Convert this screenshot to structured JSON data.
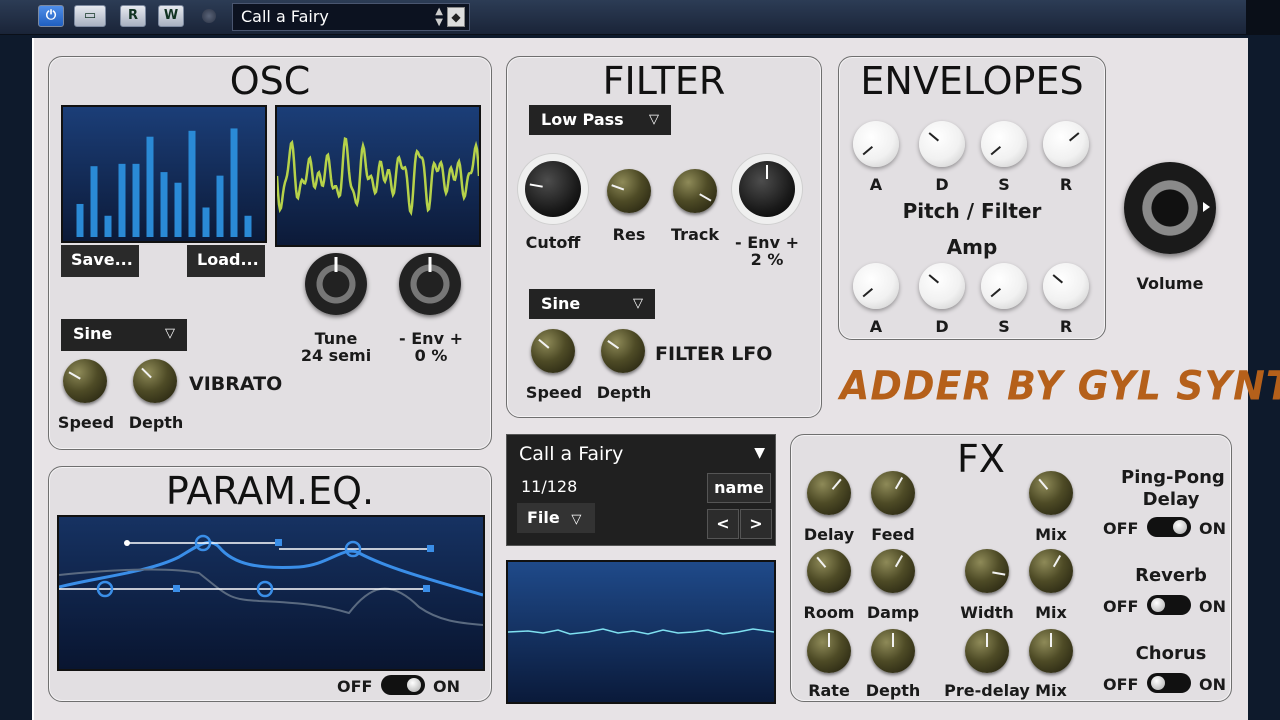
{
  "host": {
    "power_icon": "power-icon",
    "btn_r": "R",
    "btn_w": "W",
    "preset_name": "Call a Fairy"
  },
  "osc": {
    "title": "OSC",
    "save": "Save...",
    "load": "Load...",
    "tune_label": "Tune",
    "tune_value": "24 semi",
    "env_label": "- Env +",
    "env_value": "0 %",
    "vibrato_wave": "Sine",
    "vibrato_label": "VIBRATO",
    "speed": "Speed",
    "depth": "Depth",
    "harmonics": [
      0.28,
      0.6,
      0.18,
      0.62,
      0.62,
      0.85,
      0.55,
      0.46,
      0.9,
      0.25,
      0.52,
      0.92,
      0.18
    ]
  },
  "filter": {
    "title": "FILTER",
    "type": "Low Pass",
    "cutoff": "Cutoff",
    "res": "Res",
    "track": "Track",
    "env_label": "- Env +",
    "env_value": "2 %",
    "lfo_wave": "Sine",
    "lfo_label": "FILTER LFO",
    "speed": "Speed",
    "depth": "Depth"
  },
  "envelopes": {
    "title": "ENVELOPES",
    "pitch_filter_label": "Pitch / Filter",
    "amp_label": "Amp",
    "a": "A",
    "d": "D",
    "s": "S",
    "r": "R"
  },
  "volume": {
    "label": "Volume"
  },
  "brand": {
    "text": "ADDER BY GYL SYNTH"
  },
  "preset": {
    "name": "Call a Fairy",
    "count": "11/128",
    "name_btn": "name",
    "file": "File",
    "prev": "<",
    "next": ">"
  },
  "eq": {
    "title": "PARAM.EQ.",
    "off": "OFF",
    "on": "ON"
  },
  "fx": {
    "title": "FX",
    "delay": "Delay",
    "feed": "Feed",
    "mix": "Mix",
    "room": "Room",
    "damp": "Damp",
    "width": "Width",
    "rate": "Rate",
    "depth": "Depth",
    "predelay": "Pre-delay",
    "ping_pong": "Ping-Pong",
    "delay_word": "Delay",
    "reverb": "Reverb",
    "chorus": "Chorus",
    "off": "OFF",
    "on": "ON"
  },
  "colors": {
    "bar_blue": "#2a8ad6",
    "wave_green": "#b6d24a",
    "brand_orange": "#b5601a",
    "eq_line": "#3a8ee8"
  }
}
